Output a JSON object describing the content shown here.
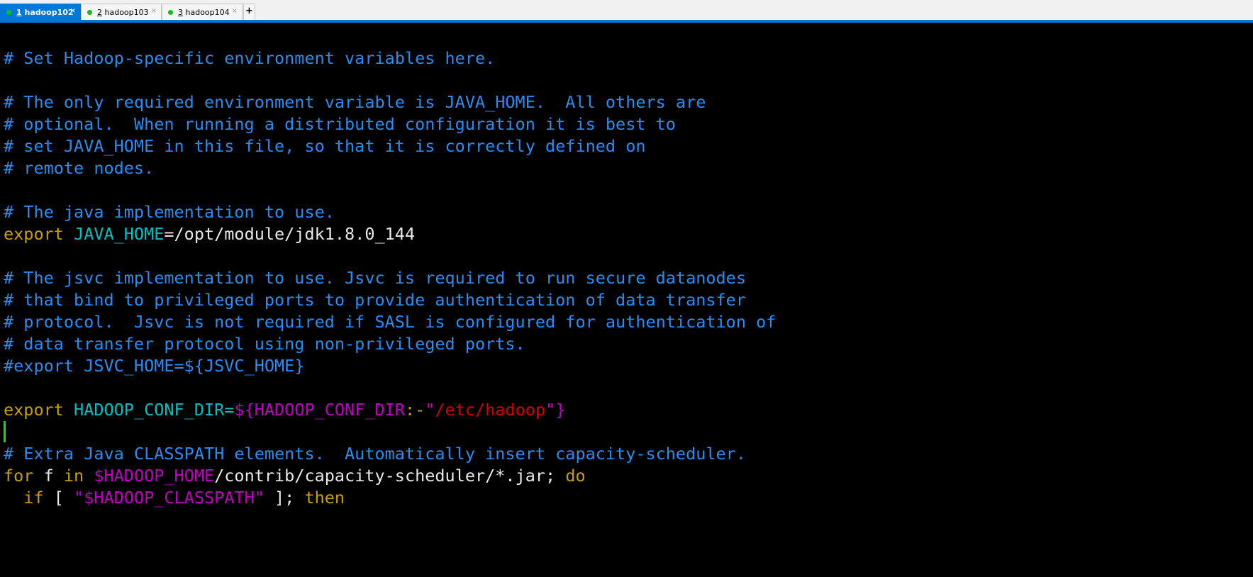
{
  "tabs": [
    {
      "num": "1",
      "label": "hadoop102",
      "active": true,
      "close": "×"
    },
    {
      "num": "2",
      "label": "hadoop103",
      "active": false,
      "close": "×"
    },
    {
      "num": "3",
      "label": "hadoop104",
      "active": false,
      "close": "×"
    }
  ],
  "new_tab_label": "+",
  "colors": {
    "comment": "#2b8cf0",
    "keyword": "#c8a000",
    "variable": "#00c0c0",
    "expansion": "#c000c0",
    "string": "#d00000",
    "tab_active": "#0078d7",
    "status_dot": "#10c010",
    "cursor": "#10e010"
  },
  "terminal": {
    "lines": [
      [],
      [
        [
          "c",
          "# Set Hadoop-specific environment variables here."
        ]
      ],
      [],
      [
        [
          "c",
          "# The only required environment variable is JAVA_HOME.  All others are"
        ]
      ],
      [
        [
          "c",
          "# optional.  When running a distributed configuration it is best to"
        ]
      ],
      [
        [
          "c",
          "# set JAVA_HOME in this file, so that it is correctly defined on"
        ]
      ],
      [
        [
          "c",
          "# remote nodes."
        ]
      ],
      [],
      [
        [
          "c",
          "# The java implementation to use."
        ]
      ],
      [
        [
          "y",
          "export"
        ],
        [
          "w",
          " "
        ],
        [
          "cy",
          "JAVA_HOME"
        ],
        [
          "w",
          "=/opt/module/jdk1.8.0_144"
        ]
      ],
      [],
      [
        [
          "c",
          "# The jsvc implementation to use. Jsvc is required to run secure datanodes"
        ]
      ],
      [
        [
          "c",
          "# that bind to privileged ports to provide authentication of data transfer"
        ]
      ],
      [
        [
          "c",
          "# protocol.  Jsvc is not required if SASL is configured for authentication of"
        ]
      ],
      [
        [
          "c",
          "# data transfer protocol using non-privileged ports."
        ]
      ],
      [
        [
          "c",
          "#export JSVC_HOME=${JSVC_HOME}"
        ]
      ],
      [],
      [
        [
          "y",
          "export"
        ],
        [
          "w",
          " "
        ],
        [
          "cy",
          "HADOOP_CONF_DIR="
        ],
        [
          "m",
          "${HADOOP_CONF_DIR"
        ],
        [
          "y",
          ":-"
        ],
        [
          "m",
          "\""
        ],
        [
          "r",
          "/etc/hadoop"
        ],
        [
          "m",
          "\"}"
        ]
      ],
      [],
      [
        [
          "c",
          "# Extra Java CLASSPATH elements.  Automatically insert capacity-scheduler."
        ]
      ],
      [
        [
          "y",
          "for"
        ],
        [
          "w",
          " f "
        ],
        [
          "y",
          "in"
        ],
        [
          "w",
          " "
        ],
        [
          "m",
          "$HADOOP_HOME"
        ],
        [
          "w",
          "/contrib/capacity-scheduler/*.jar; "
        ],
        [
          "y",
          "do"
        ]
      ],
      [
        [
          "w",
          "  "
        ],
        [
          "y",
          "if"
        ],
        [
          "w",
          " [ "
        ],
        [
          "m",
          "\"$HADOOP_CLASSPATH\""
        ],
        [
          "w",
          " ]; "
        ],
        [
          "y",
          "then"
        ]
      ]
    ]
  }
}
